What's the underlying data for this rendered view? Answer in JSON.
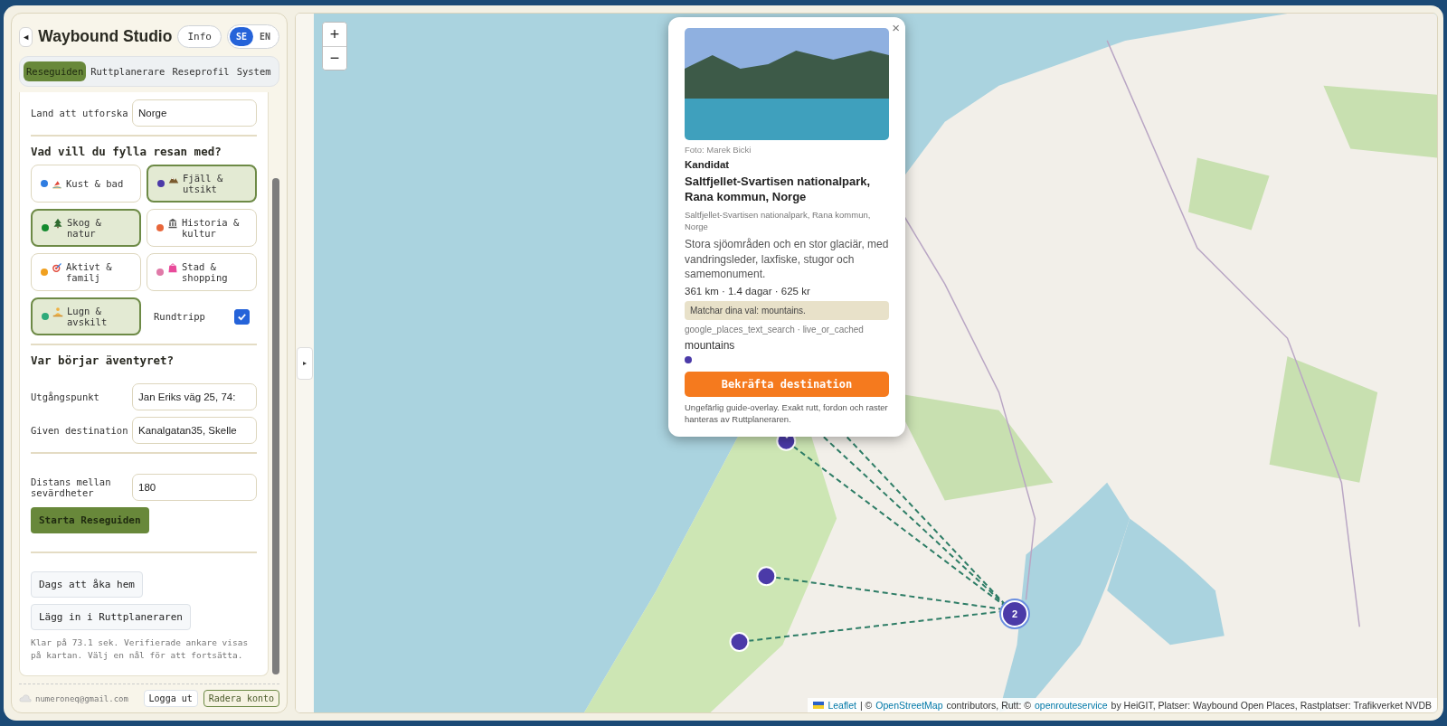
{
  "sidebar": {
    "back_button": "◄",
    "title": "Waybound Studio",
    "info_button": "Info",
    "languages": [
      {
        "label": "SE",
        "selected": true
      },
      {
        "label": "EN",
        "selected": false
      }
    ],
    "tabs": [
      {
        "label": "Reseguiden",
        "selected": true
      },
      {
        "label": "Ruttplanerare",
        "selected": false
      },
      {
        "label": "Reseprofil",
        "selected": false
      },
      {
        "label": "System",
        "selected": false
      }
    ],
    "country": {
      "label": "Land att utforska",
      "value": "Norge"
    },
    "interests_heading": "Vad vill du fylla resan med?",
    "interests": [
      {
        "label": "Kust & bad",
        "color": "#2f7de1",
        "selected": false
      },
      {
        "label": "Fjäll & utsikt",
        "color": "#4b3aa8",
        "selected": true
      },
      {
        "label": "Skog & natur",
        "color": "#138a2e",
        "selected": true
      },
      {
        "label": "Historia & kultur",
        "color": "#e8663a",
        "selected": false
      },
      {
        "label": "Aktivt & familj",
        "color": "#f0a020",
        "selected": false
      },
      {
        "label": "Stad & shopping",
        "color": "#e07aa8",
        "selected": false
      },
      {
        "label": "Lugn & avskilt",
        "color": "#2eaa7a",
        "selected": true
      }
    ],
    "round_trip": {
      "label": "Rundtripp",
      "checked": true
    },
    "start_heading": "Var börjar äventyret?",
    "start": {
      "label": "Utgångspunkt",
      "value": "Jan Eriks väg 25, 74:"
    },
    "destination": {
      "label": "Given destination",
      "value": "Kanalgatan35, Skelle"
    },
    "distance": {
      "label": "Distans mellan sevärdheter",
      "value": "180"
    },
    "start_button": "Starta Reseguiden",
    "actions": [
      "Dags att åka hem",
      "Lägg in i Ruttplaneraren"
    ],
    "status": "Klar på 73.1 sek. Verifierade ankare visas på kartan. Välj en nål för att fortsätta.",
    "footer": {
      "email": "numeroneq@gmail.com",
      "logout": "Logga ut",
      "delete": "Radera konto"
    }
  },
  "collapse_handle": "▸",
  "map": {
    "zoom_in": "+",
    "zoom_out": "−",
    "cluster_count": "2",
    "popup": {
      "close": "×",
      "photo_credit": "Foto: Marek Bicki",
      "status": "Kandidat",
      "title": "Saltfjellet-Svartisen nationalpark, Rana kommun, Norge",
      "address": "Saltfjellet-Svartisen nationalpark, Rana kommun, Norge",
      "description": "Stora sjöområden och en stor glaciär, med vandringsleder, laxfiske, stugor och samemonument.",
      "stats": "361 km · 1.4 dagar · 625 kr",
      "match": "Matchar dina val: mountains.",
      "source": "google_places_text_search · live_or_cached",
      "tag": {
        "label": "mountains",
        "color": "#4b3aa8"
      },
      "confirm_button": "Bekräfta destination",
      "note": "Ungefärlig guide-overlay. Exakt rutt, fordon och raster hanteras av Ruttplaneraren."
    },
    "attribution": [
      {
        "kind": "link",
        "text": "Leaflet"
      },
      {
        "kind": "text",
        "text": "| ©"
      },
      {
        "kind": "link",
        "text": "OpenStreetMap"
      },
      {
        "kind": "text",
        "text": "contributors, Rutt: ©"
      },
      {
        "kind": "link",
        "text": "openrouteservice"
      },
      {
        "kind": "text",
        "text": "by HeiGIT, Platser: Waybound Open Places, Rastplatser: Trafikverket NVDB"
      }
    ]
  }
}
